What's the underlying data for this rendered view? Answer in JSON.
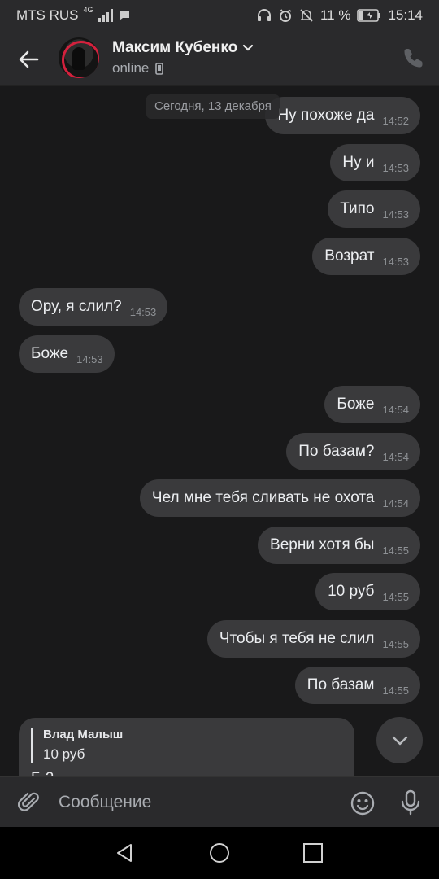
{
  "status_bar": {
    "carrier": "MTS RUS",
    "network": "4G",
    "battery": "11 %",
    "time": "15:14"
  },
  "header": {
    "name": "Максим Кубенко",
    "status": "online"
  },
  "chat": {
    "date_separator": "Сегодня, 13 декабря",
    "messages": [
      {
        "dir": "out",
        "text": "Ну похоже да",
        "time": "14:52"
      },
      {
        "dir": "out",
        "text": "Ну и",
        "time": "14:53"
      },
      {
        "dir": "out",
        "text": "Типо",
        "time": "14:53"
      },
      {
        "dir": "out",
        "text": "Возрат",
        "time": "14:53"
      },
      {
        "dir": "in",
        "text": "Ору, я слил?",
        "time": "14:53"
      },
      {
        "dir": "in",
        "text": "Боже",
        "time": "14:53"
      },
      {
        "dir": "out",
        "text": "Боже",
        "time": "14:54"
      },
      {
        "dir": "out",
        "text": "По базам?",
        "time": "14:54"
      },
      {
        "dir": "out",
        "text": "Чел мне тебя сливать не охота",
        "time": "14:54"
      },
      {
        "dir": "out",
        "text": "Верни хотя бы",
        "time": "14:55"
      },
      {
        "dir": "out",
        "text": "10 руб",
        "time": "14:55"
      },
      {
        "dir": "out",
        "text": "Чтобы я тебя не слил",
        "time": "14:55"
      },
      {
        "dir": "out",
        "text": "По базам",
        "time": "14:55"
      }
    ],
    "reply": {
      "author": "Влад Малыш",
      "quoted_text": "10 руб",
      "text_partial": "Б                2"
    }
  },
  "composer": {
    "placeholder": "Сообщение"
  },
  "colors": {
    "background": "#19191a",
    "bar": "#2a2a2c",
    "bubble": "#3a3a3c",
    "accent_avatar": "#d4213d"
  },
  "icons": {
    "back": "arrow-left-icon",
    "call": "phone-icon",
    "attach": "paperclip-icon",
    "emoji": "smile-icon",
    "mic": "microphone-icon",
    "scroll": "chevron-down-icon"
  }
}
